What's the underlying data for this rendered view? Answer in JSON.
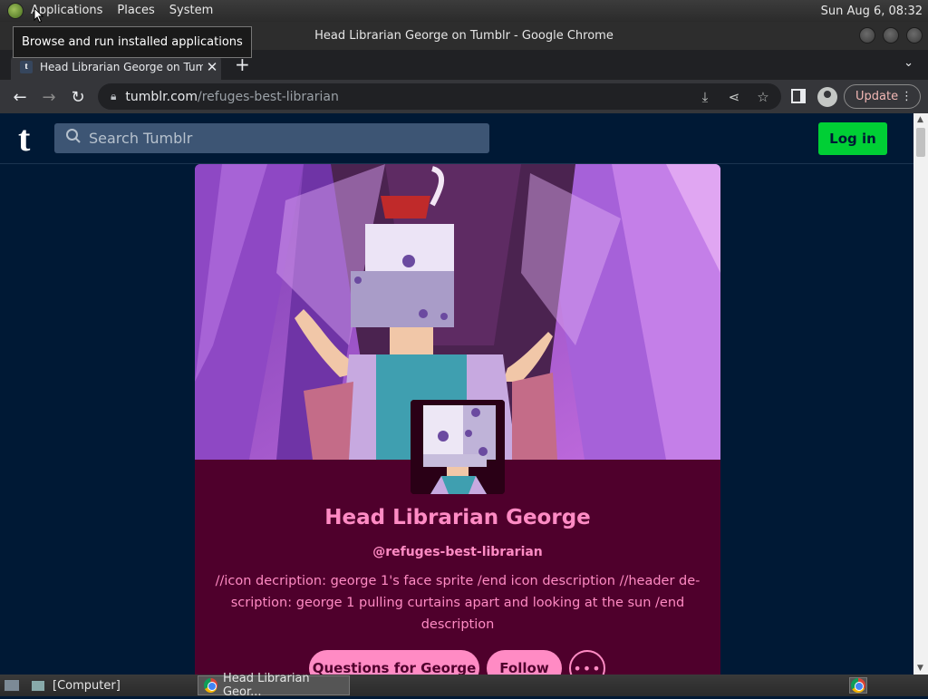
{
  "panel": {
    "menus": [
      "Applications",
      "Places",
      "System"
    ],
    "clock": "Sun Aug  6, 08:32"
  },
  "tooltip": "Browse and run installed applications",
  "window": {
    "title": "Head Librarian George on Tumblr - Google Chrome"
  },
  "tab": {
    "favicon": "t",
    "title": "Head Librarian George on Tumblr",
    "close": "✕"
  },
  "toolbar": {
    "url_host": "tumblr.com",
    "url_path": "/refuges-best-librarian",
    "update_label": "Update"
  },
  "site": {
    "search_placeholder": "Search Tumblr",
    "login_label": "Log in",
    "logo": "t"
  },
  "blog": {
    "title": "Head Librarian George",
    "handle": "@refuges-best-librarian",
    "description": "//icon decription: george 1's face sprite /end icon description //header de-scription: george 1 pulling curtains apart and looking at the sun /end description",
    "questions_label": "Questions for George",
    "follow_label": "Follow",
    "more_label": "•••"
  },
  "taskbar": {
    "items": [
      "[Computer]",
      "Head Librarian Geor..."
    ]
  },
  "colors": {
    "page_bg": "#001935",
    "card_bg": "#4f002c",
    "accent_pink": "#ff8bc4",
    "login_green": "#00cf35"
  }
}
